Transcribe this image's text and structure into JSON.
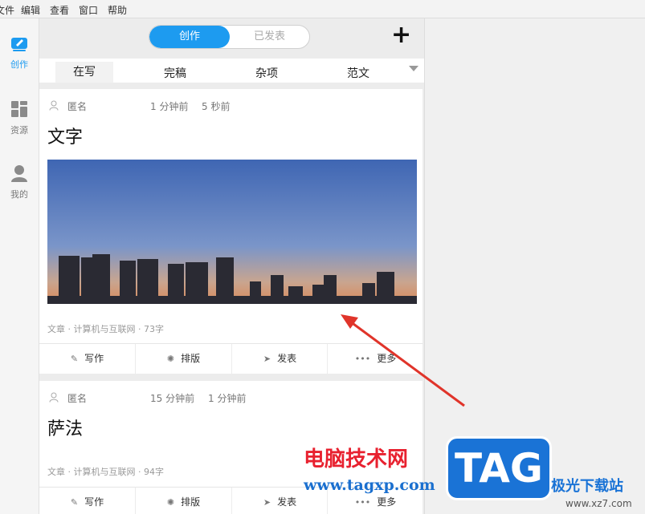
{
  "menu": [
    "文件",
    "编辑",
    "查看",
    "窗口",
    "帮助"
  ],
  "sidebar": [
    {
      "label": "创作",
      "icon": "pen-icon",
      "active": true
    },
    {
      "label": "资源",
      "icon": "grid-icon",
      "active": false
    },
    {
      "label": "我的",
      "icon": "user-icon",
      "active": false
    }
  ],
  "segment": {
    "left": "创作",
    "right": "已发表"
  },
  "tabs": [
    "在写",
    "完稿",
    "杂项",
    "范文"
  ],
  "cards": [
    {
      "author": "匿名",
      "created": "1 分钟前",
      "modified": "5 秒前",
      "title": "文字",
      "tagline": "文章 · 计算机与互联网 · 73字"
    },
    {
      "author": "匿名",
      "created": "15 分钟前",
      "modified": "1 分钟前",
      "title": "萨法",
      "tagline": "文章 · 计算机与互联网 · 94字"
    }
  ],
  "actions": [
    "写作",
    "排版",
    "发表",
    "更多"
  ],
  "watermark": {
    "title": "电脑技术网",
    "url": "www.tagxp.com",
    "tag": "TAG",
    "site_name": "极光下载站",
    "site_url": "www.xz7.com"
  },
  "colors": {
    "accent": "#1d9bf0",
    "arrow": "#e0342a"
  }
}
